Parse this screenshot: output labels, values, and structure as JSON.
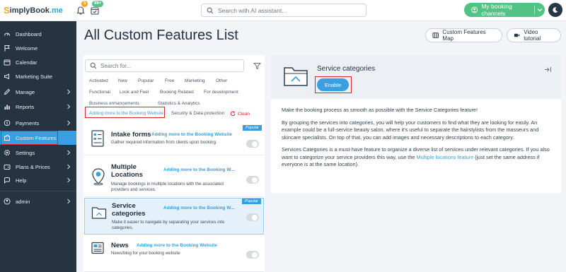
{
  "topbar": {
    "logo_prefix": "S",
    "logo_name": "implyBook",
    "logo_suffix": ".me",
    "bell_badge": "5",
    "tasks_badge": "99+",
    "search_placeholder": "Search with AI assistant...",
    "channels_label": "My booking channels",
    "colors": {
      "accent": "#3a9fe0",
      "green": "#53c285",
      "sidebar": "#263441",
      "alert": "#d8262c"
    }
  },
  "sidebar": {
    "items": [
      {
        "label": "Dashboard",
        "icon": "dashboard-icon",
        "chevron": false
      },
      {
        "label": "Welcome",
        "icon": "flag-icon",
        "chevron": false
      },
      {
        "label": "Calendar",
        "icon": "calendar-icon",
        "chevron": false
      },
      {
        "label": "Marketing Suite",
        "icon": "megaphone-icon",
        "chevron": false
      },
      {
        "label": "Manage",
        "icon": "pencil-icon",
        "chevron": true
      },
      {
        "label": "Reports",
        "icon": "chart-icon",
        "chevron": true
      },
      {
        "label": "Payments",
        "icon": "payments-icon",
        "chevron": true
      },
      {
        "label": "Custom Features",
        "icon": "puzzle-icon",
        "chevron": false,
        "active": true
      },
      {
        "label": "Settings",
        "icon": "gear-icon",
        "chevron": true
      },
      {
        "label": "Plans & Prices",
        "icon": "wallet-icon",
        "chevron": true
      },
      {
        "label": "Help",
        "icon": "help-icon",
        "chevron": true
      },
      {
        "label": "admin",
        "icon": "user-icon",
        "chevron": true
      }
    ]
  },
  "main": {
    "title": "All Custom Features List",
    "map_button": "Custom Features Map",
    "video_button": "Video tutorial"
  },
  "filters": {
    "search_placeholder": "Search for...",
    "tags": [
      "Activated",
      "New",
      "Popular",
      "Free",
      "Marketing",
      "Other",
      "Functional",
      "Look and Feel",
      "Booking Related",
      "For development",
      "Business enhancements",
      "Statistics & Analytics",
      "Adding more to the Booking Website",
      "Security & Data protection"
    ],
    "clean_label": "Clean"
  },
  "features": [
    {
      "title": "Intake forms",
      "category": "Adding more to the Booking Website",
      "description": "Gather required information from clients upon booking.",
      "popular": "Popular"
    },
    {
      "title_line1": "Multiple",
      "title_line2": "Locations",
      "category": "Adding more to the Booking W...",
      "desc_line1": "Manage bookings in multiple locations with the associated",
      "desc_line2": "providers and services."
    },
    {
      "title_line1": "Service",
      "title_line2": "categories",
      "category": "Adding more to the Booking W...",
      "desc_line1": "Make it easier to navigate by separating your services into",
      "desc_line2": "categories.",
      "popular": "Popular"
    },
    {
      "title": "News",
      "category": "Adding more to the Booking Website",
      "description": "News/blog for your booking website"
    }
  ],
  "detail": {
    "title": "Service categories",
    "enable_label": "Enable",
    "p1": "Make the booking process as smooth as possible with the Service Categories feature!",
    "p2": "By grouping the services into categories, you will help your customers to find what they are looking for easily. An example could be a full-service beauty salon, where it's useful to separate the hairstylists from the masseurs and skincare specialists. On top of that, you can add images and necessary descriptions to each category.",
    "p3_before": "Services Categories is a must-have feature to organize a diverse list of services under relevant categories. If you also want to categorize your service providers this way, use the ",
    "p3_link": "Multiple locations feature",
    "p3_after": " (just set the same address if everyone is at the same location)."
  }
}
